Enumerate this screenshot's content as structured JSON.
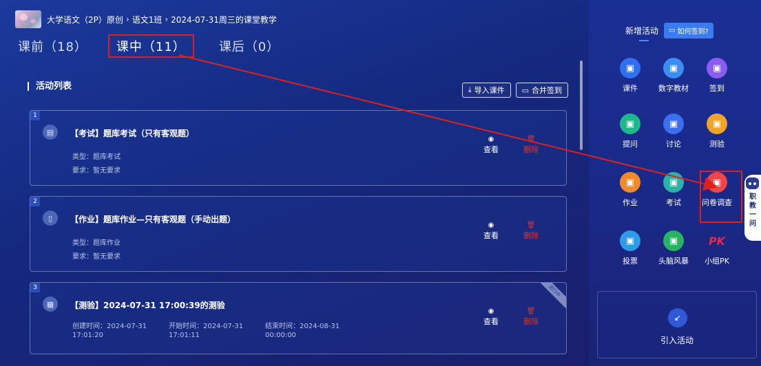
{
  "header": {
    "breadcrumb": [
      "大学语文（2P）原创",
      "语文1班",
      "2024-07-31周三的课堂教学"
    ],
    "separator": "›"
  },
  "tabs": [
    {
      "label": "课前（18）",
      "active": false
    },
    {
      "label": "课中（11）",
      "active": true
    },
    {
      "label": "课后（0）",
      "active": false
    }
  ],
  "activity_list": {
    "title": "活动列表",
    "import_courseware": "导入课件",
    "merge_signin": "合并签到",
    "view_label": "查看",
    "delete_label": "删除",
    "items": [
      {
        "index": "1",
        "title": "【考试】题库考试（只有客观题）",
        "line1": "类型：题库考试",
        "line2": "要求：暂无要求"
      },
      {
        "index": "2",
        "title": "【作业】题库作业—只有客观题（手动出题）",
        "line1": "类型：题库作业",
        "line2": "要求：暂无要求"
      },
      {
        "index": "3",
        "title": "【测验】2024-07-31 17:00:39的测验",
        "badge": "进行中",
        "created": "创建时间：2024-07-31 17:01:20",
        "start": "开始时间：2024-07-31 17:01:11",
        "end": "结束时间：2024-08-31 00:00:00"
      }
    ]
  },
  "right_panel": {
    "title": "新增活动",
    "howto_label": "如何签到?",
    "activities": [
      {
        "label": "课件",
        "icon": "courseware-icon",
        "color": "#2f6ff0"
      },
      {
        "label": "数字教材",
        "icon": "digital-textbook-icon",
        "color": "#3a8df5"
      },
      {
        "label": "签到",
        "icon": "signin-icon",
        "color": "#8a5cf0"
      },
      {
        "label": "提问",
        "icon": "question-icon",
        "color": "#1fb88a"
      },
      {
        "label": "讨论",
        "icon": "discussion-icon",
        "color": "#3b6ff2"
      },
      {
        "label": "测验",
        "icon": "quiz-icon",
        "color": "#f0a52a"
      },
      {
        "label": "作业",
        "icon": "homework-icon",
        "color": "#f08a2a"
      },
      {
        "label": "考试",
        "icon": "exam-icon",
        "color": "#2bb3a6"
      },
      {
        "label": "问卷调查",
        "icon": "survey-icon",
        "color": "#f0454a"
      },
      {
        "label": "投票",
        "icon": "vote-icon",
        "color": "#2e9be8"
      },
      {
        "label": "头脑风暴",
        "icon": "brainstorm-icon",
        "color": "#27b35f"
      },
      {
        "label": "小组PK",
        "icon": "group-pk-icon",
        "color": "#e8254a",
        "glyph": "PK"
      }
    ],
    "import_activity": "引入活动"
  },
  "assistant": {
    "label": "职教一问"
  },
  "colors": {
    "accent": "#3b7bf2",
    "highlight": "#e0201d",
    "danger": "#e0322c"
  }
}
